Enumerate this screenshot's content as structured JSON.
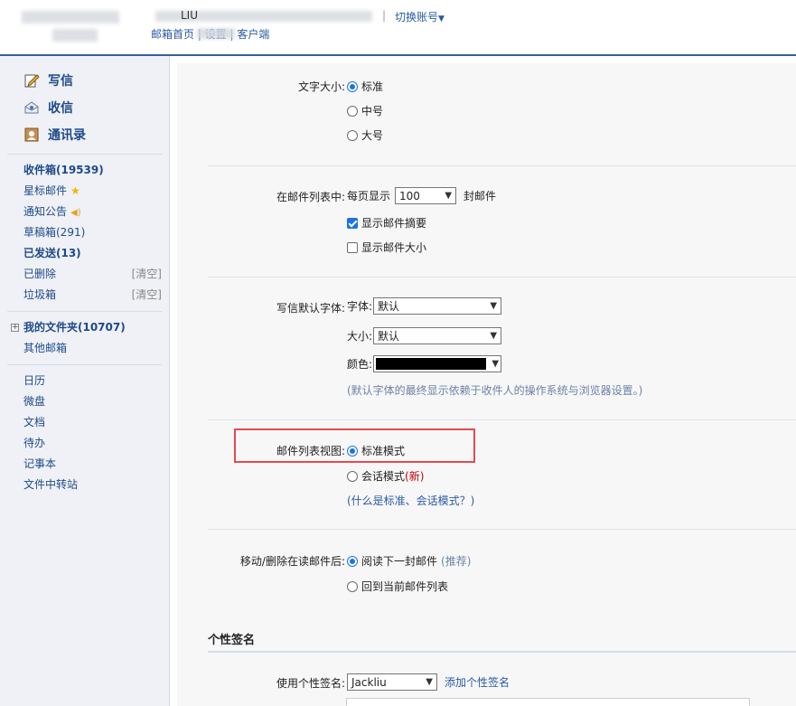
{
  "header": {
    "account_name": "LIU",
    "switch_account": "切换账号",
    "links": "邮箱首页 | 设置 | 客户端"
  },
  "sidebar": {
    "main": [
      {
        "label": "写信",
        "icon": "compose-icon"
      },
      {
        "label": "收信",
        "icon": "inbox-icon"
      },
      {
        "label": "通讯录",
        "icon": "contacts-icon"
      }
    ],
    "folders": [
      {
        "label": "收件箱(19539)"
      },
      {
        "label": "星标邮件"
      },
      {
        "label": "通知公告"
      },
      {
        "label": "草稿箱(291)"
      },
      {
        "label": "已发送(13)"
      },
      {
        "label": "已删除",
        "action": "[清空]"
      },
      {
        "label": "垃圾箱",
        "action": "[清空]"
      }
    ],
    "my_folders": "我的文件夹(10707)",
    "other_mail": "其他邮箱",
    "apps": [
      "日历",
      "微盘",
      "文档",
      "待办",
      "记事本",
      "文件中转站"
    ]
  },
  "settings": {
    "font_size": {
      "label": "文字大小:",
      "options": [
        "标准",
        "中号",
        "大号"
      ],
      "selected": 0
    },
    "mail_list": {
      "label": "在邮件列表中:",
      "per_page_prefix": "每页显示",
      "per_page_value": "100",
      "per_page_suffix": "封邮件",
      "show_summary": "显示邮件摘要",
      "show_summary_checked": true,
      "show_size": "显示邮件大小",
      "show_size_checked": false
    },
    "default_font": {
      "label": "写信默认字体:",
      "font_label": "字体:",
      "font_value": "默认",
      "size_label": "大小:",
      "size_value": "默认",
      "color_label": "颜色:",
      "color_value": "#000000",
      "hint": "(默认字体的最终显示依赖于收件人的操作系统与浏览器设置。)"
    },
    "list_view": {
      "label": "邮件列表视图:",
      "standard": "标准模式",
      "conversation": "会话模式",
      "conversation_new": "(新)",
      "help_link": "(什么是标准、会话模式？)",
      "selected": 0
    },
    "after_move_delete": {
      "label": "移动/删除在读邮件后:",
      "next": "阅读下一封邮件",
      "next_rec": "(推荐)",
      "back": "回到当前邮件列表",
      "selected": 0
    },
    "signature": {
      "section_title": "个性签名",
      "label": "使用个性签名:",
      "value": "Jackliu",
      "add_link": "添加个性签名"
    }
  },
  "colors": {
    "accent_blue": "#2a5aa5",
    "highlight_red": "#e8494f",
    "radio_blue": "#1a73e8"
  }
}
